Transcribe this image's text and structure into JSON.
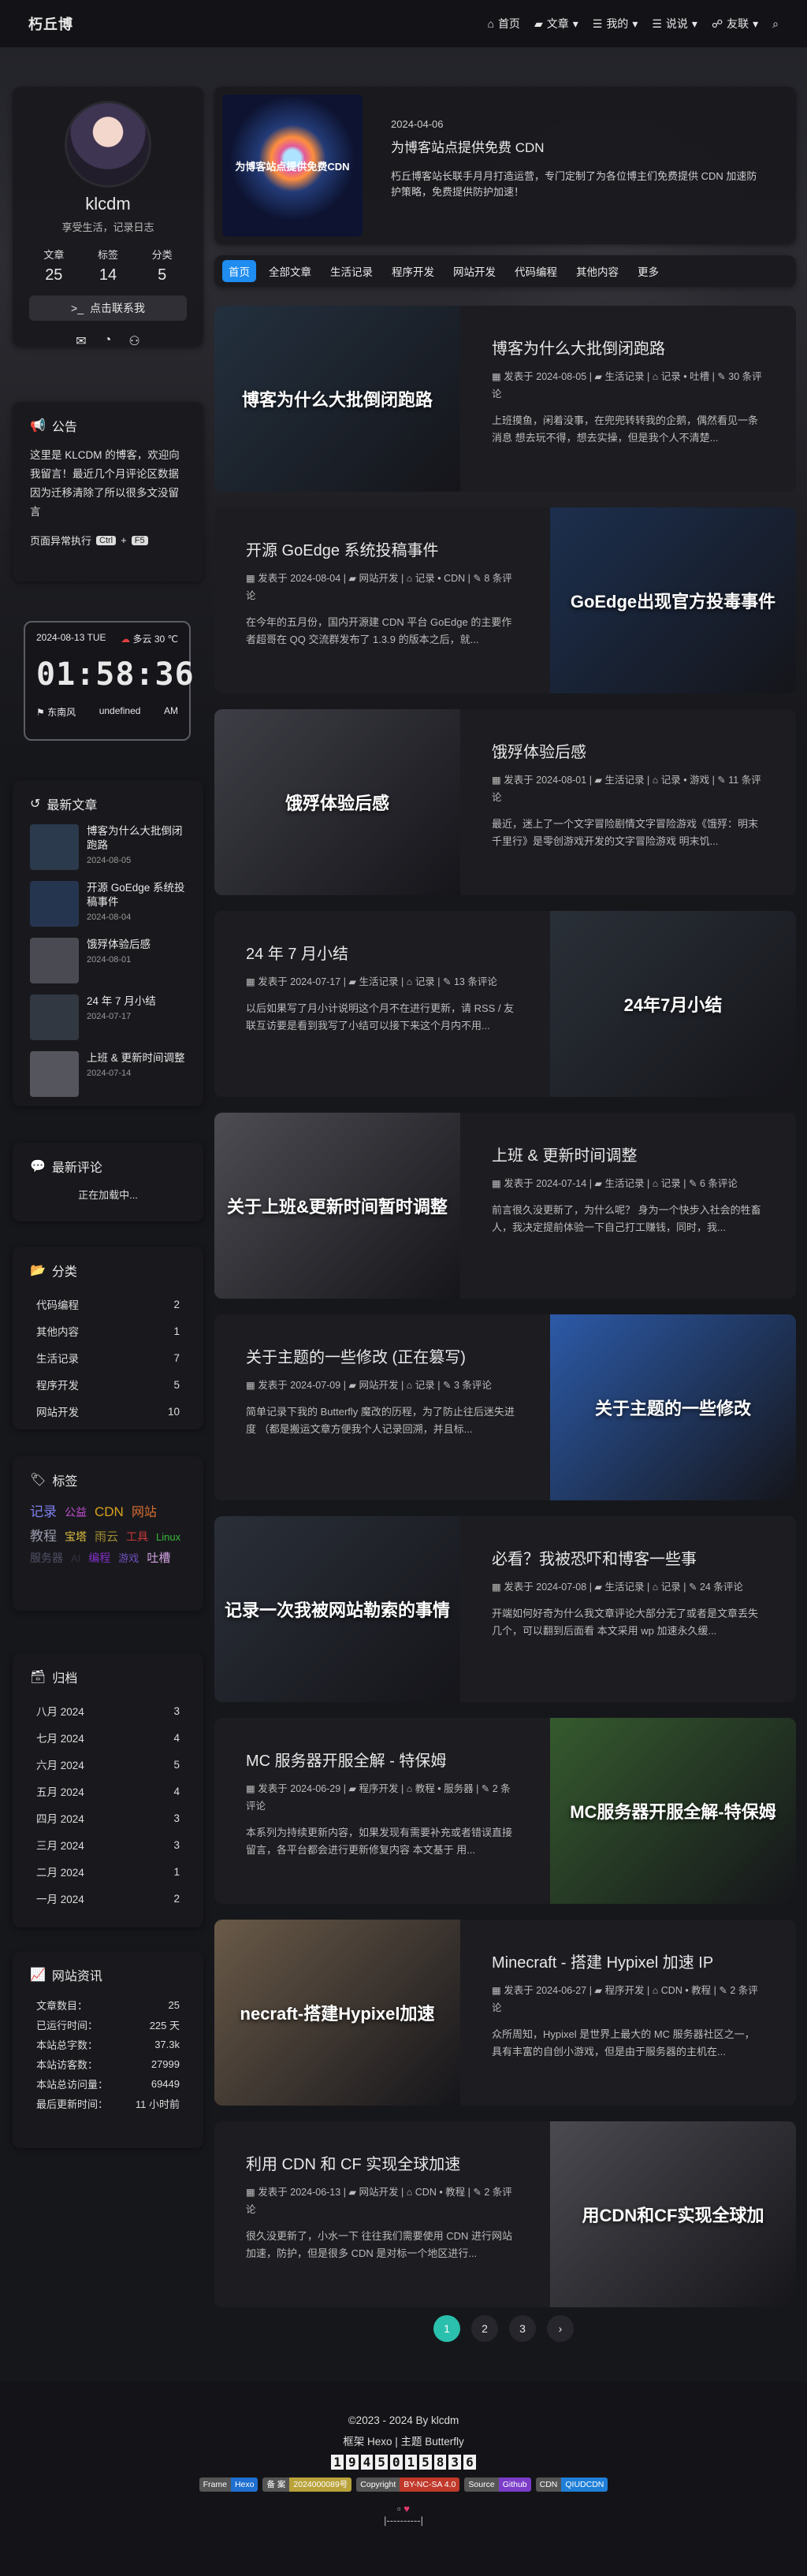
{
  "nav": {
    "brand": "朽丘博",
    "items": [
      {
        "icon": "home-icon",
        "label": "首页",
        "dropdown": false
      },
      {
        "icon": "folder-icon",
        "label": "文章",
        "dropdown": true
      },
      {
        "icon": "list-icon",
        "label": "我的",
        "dropdown": true
      },
      {
        "icon": "list-icon",
        "label": "说说",
        "dropdown": true
      },
      {
        "icon": "link-icon",
        "label": "友联",
        "dropdown": true
      }
    ]
  },
  "author": {
    "name": "klcdm",
    "desc": "享受生活，记录日志",
    "stats": [
      {
        "label": "文章",
        "value": "25"
      },
      {
        "label": "标签",
        "value": "14"
      },
      {
        "label": "分类",
        "value": "5"
      }
    ],
    "contact": "点击联系我"
  },
  "announcement": {
    "title": "公告",
    "text": "这里是 KLCDM 的博客，欢迎向我留言！最近几个月评论区数据因为迁移清除了所以很多文没留言",
    "status_prefix": "页面异常执行",
    "key1": "Ctrl",
    "plus": "+",
    "key2": "F5"
  },
  "clock": {
    "date": "2024-08-13 TUE",
    "weather": "多云 30 ℃",
    "time": "01:58:36",
    "wind": "东南风",
    "wind_level": "undefined",
    "ampm": "AM"
  },
  "recent": {
    "title": "最新文章",
    "items": [
      {
        "title": "博客为什么大批倒闭跑路",
        "date": "2024-08-05"
      },
      {
        "title": "开源 GoEdge 系统投稿事件",
        "date": "2024-08-04"
      },
      {
        "title": "饿殍体验后感",
        "date": "2024-08-01"
      },
      {
        "title": "24 年 7 月小结",
        "date": "2024-07-17"
      },
      {
        "title": "上班 & 更新时间调整",
        "date": "2024-07-14"
      }
    ]
  },
  "comments": {
    "title": "最新评论",
    "loading": "正在加载中..."
  },
  "categories": {
    "title": "分类",
    "items": [
      {
        "name": "代码编程",
        "count": "2"
      },
      {
        "name": "其他内容",
        "count": "1"
      },
      {
        "name": "生活记录",
        "count": "7"
      },
      {
        "name": "程序开发",
        "count": "5"
      },
      {
        "name": "网站开发",
        "count": "10"
      }
    ]
  },
  "tags": {
    "title": "标签",
    "items": [
      {
        "name": "记录",
        "color": "#7f7ff0",
        "size": "17"
      },
      {
        "name": "公益",
        "color": "#c450d4",
        "size": "14"
      },
      {
        "name": "CDN",
        "color": "#d8a020",
        "size": "17"
      },
      {
        "name": "网站",
        "color": "#d86c30",
        "size": "16"
      },
      {
        "name": "教程",
        "color": "#9a9aaa",
        "size": "17"
      },
      {
        "name": "宝塔",
        "color": "#e0c040",
        "size": "14"
      },
      {
        "name": "雨云",
        "color": "#a08a30",
        "size": "15"
      },
      {
        "name": "工具",
        "color": "#c83838",
        "size": "14"
      },
      {
        "name": "Linux",
        "color": "#38b838",
        "size": "13"
      },
      {
        "name": "服务器",
        "color": "#505068",
        "size": "14"
      },
      {
        "name": "AI",
        "color": "#303040",
        "size": "13"
      },
      {
        "name": "编程",
        "color": "#8030c8",
        "size": "14"
      },
      {
        "name": "游戏",
        "color": "#7050c0",
        "size": "13"
      },
      {
        "name": "吐槽",
        "color": "#d0a0e0",
        "size": "15"
      }
    ]
  },
  "archives": {
    "title": "归档",
    "items": [
      {
        "month": "八月 2024",
        "count": "3"
      },
      {
        "month": "七月 2024",
        "count": "4"
      },
      {
        "month": "六月 2024",
        "count": "5"
      },
      {
        "month": "五月 2024",
        "count": "4"
      },
      {
        "month": "四月 2024",
        "count": "3"
      },
      {
        "month": "三月 2024",
        "count": "3"
      },
      {
        "month": "二月 2024",
        "count": "1"
      },
      {
        "month": "一月 2024",
        "count": "2"
      }
    ]
  },
  "siteinfo": {
    "title": "网站资讯",
    "rows": [
      {
        "label": "文章数目：",
        "value": "25"
      },
      {
        "label": "已运行时间：",
        "value": "225 天"
      },
      {
        "label": "本站总字数：",
        "value": "37.3k"
      },
      {
        "label": "本站访客数：",
        "value": "27999"
      },
      {
        "label": "本站总访问量：",
        "value": "69449"
      },
      {
        "label": "最后更新时间：",
        "value": "11 小时前"
      }
    ]
  },
  "featured": {
    "date": "2024-04-06",
    "title": "为博客站点提供免费 CDN",
    "desc": "朽丘博客站长联手月月打造运营，专门定制了为各位博主们免费提供 CDN 加速防护策略，免费提供防护加速！",
    "img_text": "为博客站点提供免费CDN"
  },
  "catbar": [
    "首页",
    "全部文章",
    "生活记录",
    "程序开发",
    "网站开发",
    "代码编程",
    "其他内容",
    "更多"
  ],
  "posts": [
    {
      "title": "博客为什么大批倒闭跑路",
      "date": "发表于 2024-08-05",
      "cat": "生活记录",
      "tags": "记录 • 吐槽",
      "comments": "30 条评论",
      "excerpt": "上班摸鱼，闲着没事，在兜兜转转我的企鹅，偶然看见一条消息 想去玩不得，想去实操，但是我个人不清楚...",
      "img_title": "博客为什么大批倒闭跑路",
      "side": "left",
      "bg": "#23303e"
    },
    {
      "title": "开源 GoEdge 系统投稿事件",
      "date": "发表于 2024-08-04",
      "cat": "网站开发",
      "tags": "记录 • CDN",
      "comments": "8 条评论",
      "excerpt": "在今年的五月份，国内开源建 CDN 平台 GoEdge 的主要作者超哥在 QQ 交流群发布了 1.3.9 的版本之后，就...",
      "img_title": "GoEdge出现官方投毒事件",
      "side": "right",
      "bg": "#1c2f4e"
    },
    {
      "title": "饿殍体验后感",
      "date": "发表于 2024-08-01",
      "cat": "生活记录",
      "tags": "记录 • 游戏",
      "comments": "11 条评论",
      "excerpt": "最近，迷上了一个文字冒险剧情文字冒险游戏《饿殍：明末千里行》是零创游戏开发的文字冒险游戏 明末饥...",
      "img_title": "饿殍体验后感",
      "side": "left",
      "bg": "#3e3e46"
    },
    {
      "title": "24 年 7 月小结",
      "date": "发表于 2024-07-17",
      "cat": "生活记录",
      "tags": "记录",
      "comments": "13 条评论",
      "excerpt": "以后如果写了月小计说明这个月不在进行更新，请 RSS / 友联互访要是看到我写了小结可以接下来这个月内不用...",
      "img_title": "24年7月小结",
      "side": "right",
      "bg": "#2a3038"
    },
    {
      "title": "上班 & 更新时间调整",
      "date": "发表于 2024-07-14",
      "cat": "生活记录",
      "tags": "记录",
      "comments": "6 条评论",
      "excerpt": "前言很久没更新了，为什么呢？ 身为一个快步入社会的牲畜人，我决定提前体验一下自己打工赚钱，同时，我...",
      "img_title": "关于上班&更新时间暂时调整",
      "side": "left",
      "bg": "#4c4c52"
    },
    {
      "title": "关于主题的一些修改 (正在篡写)",
      "date": "发表于 2024-07-09",
      "cat": "网站开发",
      "tags": "记录",
      "comments": "3 条评论",
      "excerpt": "简单记录下我的 Butterfly 魔改的历程，为了防止往后迷失进度 （都是搬运文章方便我个人记录回溯，并且标...",
      "img_title": "关于主题的一些修改",
      "side": "right",
      "bg": "#2c5aa8"
    },
    {
      "title": "必看？我被恐吓和博客一些事",
      "date": "发表于 2024-07-08",
      "cat": "生活记录",
      "tags": "记录",
      "comments": "24 条评论",
      "excerpt": "开端如何好奇为什么我文章评论大部分无了或者是文章丢失几个，可以翻到后面看 本文采用 wp 加速永久缓...",
      "img_title": "记录一次我被网站勒索的事情",
      "side": "left",
      "bg": "#2a2f38"
    },
    {
      "title": "MC 服务器开服全解 - 特保姆",
      "date": "发表于 2024-06-29",
      "cat": "程序开发",
      "tags": "教程 • 服务器",
      "comments": "2 条评论",
      "excerpt": "本系列为持续更新内容，如果发现有需要补充或者错误直接留言，各平台都会进行更新修复内容 本文基于 用...",
      "img_title": "MC服务器开服全解-特保姆",
      "side": "right",
      "bg": "#355a2e"
    },
    {
      "title": "Minecraft - 搭建 Hypixel 加速 IP",
      "date": "发表于 2024-06-27",
      "cat": "程序开发",
      "tags": "CDN • 教程",
      "comments": "2 条评论",
      "excerpt": "众所周知，Hypixel 是世界上最大的 MC 服务器社区之一，具有丰富的自创小游戏，但是由于服务器的主机在...",
      "img_title": "necraft-搭建Hypixel加速",
      "side": "left",
      "bg": "#6a5a48"
    },
    {
      "title": "利用 CDN 和 CF 实现全球加速",
      "date": "发表于 2024-06-13",
      "cat": "网站开发",
      "tags": "CDN • 教程",
      "comments": "2 条评论",
      "excerpt": "很久没更新了，小水一下 往往我们需要使用 CDN 进行网站加速，防护，但是很多 CDN 是对标一个地区进行...",
      "img_title": "用CDN和CF实现全球加",
      "side": "right",
      "bg": "#4a4a50"
    }
  ],
  "pager": [
    "1",
    "2",
    "3",
    "›"
  ],
  "footer": {
    "copy": "©2023 - 2024 By klcdm",
    "frame": "框架 Hexo | 主题 Butterfly",
    "count": [
      "1",
      "9",
      "4",
      "5",
      "0",
      "1",
      "5",
      "8",
      "3",
      "6"
    ],
    "badges": [
      {
        "l": "Frame",
        "r": "Hexo",
        "c": "#1e6fd0"
      },
      {
        "l": "备 案",
        "r": "2024000089号",
        "c": "#b9a23a"
      },
      {
        "l": "Copyright",
        "r": "BY-NC-SA 4.0",
        "c": "#c0392b"
      },
      {
        "l": "Source",
        "r": "Github",
        "c": "#7a3cc9"
      },
      {
        "l": "CDN",
        "r": "QIUDCDN",
        "c": "#1f7fd8"
      }
    ],
    "last": "|----------|"
  }
}
